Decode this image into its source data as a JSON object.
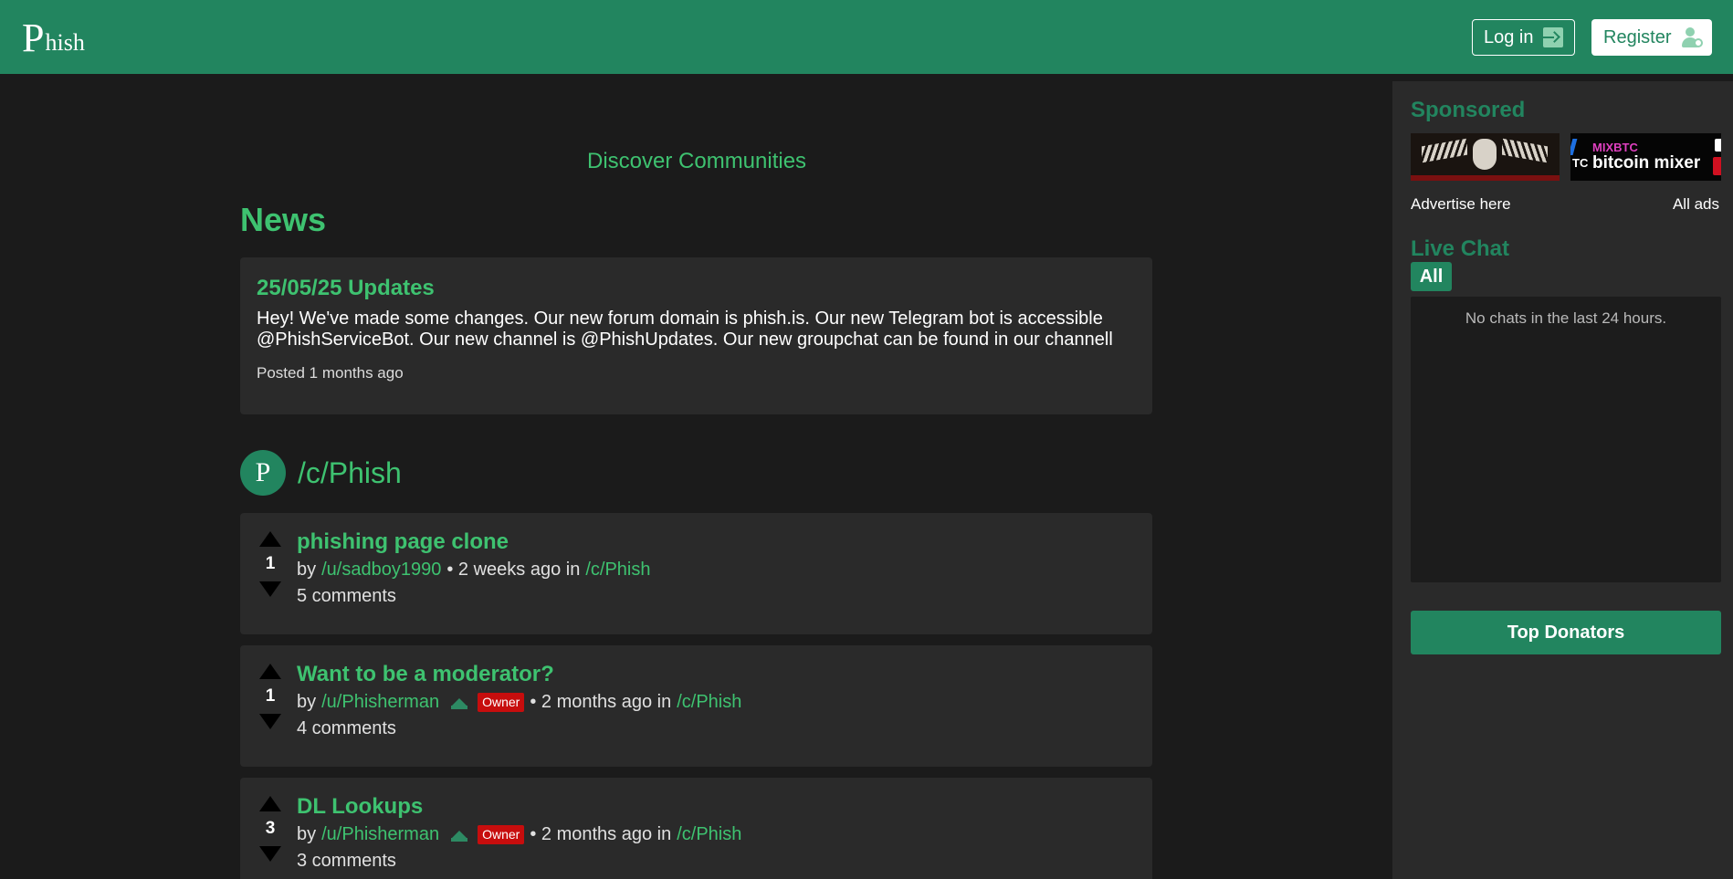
{
  "header": {
    "logo_initial": "P",
    "logo_rest": "hish",
    "login_label": "Log in",
    "register_label": "Register"
  },
  "main": {
    "discover_label": "Discover Communities",
    "news_heading": "News",
    "news": {
      "title": "25/05/25 Updates",
      "body": "Hey! We've made some changes. Our new forum domain is phish.is. Our new Telegram bot is accessible @PhishServiceBot. Our new channel is @PhishUpdates. Our new groupchat can be found in our channell",
      "posted": "Posted 1 months ago"
    },
    "community": {
      "avatar_letter": "P",
      "title": "/c/Phish"
    },
    "posts": [
      {
        "score": "1",
        "title": "phishing page clone",
        "by": "by",
        "author": "/u/sadboy1990",
        "owner": false,
        "time": "• 2 weeks ago in",
        "community": "/c/Phish",
        "comments": "5 comments"
      },
      {
        "score": "1",
        "title": "Want to be a moderator?",
        "by": "by",
        "author": "/u/Phisherman",
        "owner": true,
        "badge": "Owner",
        "time": "• 2 months ago in",
        "community": "/c/Phish",
        "comments": "4 comments"
      },
      {
        "score": "3",
        "title": "DL Lookups",
        "by": "by",
        "author": "/u/Phisherman",
        "owner": true,
        "badge": "Owner",
        "time": "• 2 months ago in",
        "community": "/c/Phish",
        "comments": "3 comments"
      }
    ]
  },
  "sidebar": {
    "sponsored_heading": "Sponsored",
    "ads": {
      "ad2_brand": "MIXBTC",
      "ad2_tagline": "bitcoin mixer",
      "ad2_cut": "TC"
    },
    "advertise_label": "Advertise here",
    "all_ads_label": "All ads",
    "live_chat_heading": "Live Chat",
    "chat_tab_all": "All",
    "chat_empty": "No chats in the last 24 hours.",
    "top_donators_label": "Top Donators"
  },
  "colors": {
    "brand_green": "#22855f",
    "link_green": "#3ec270",
    "owner_badge": "#c70d0d"
  }
}
